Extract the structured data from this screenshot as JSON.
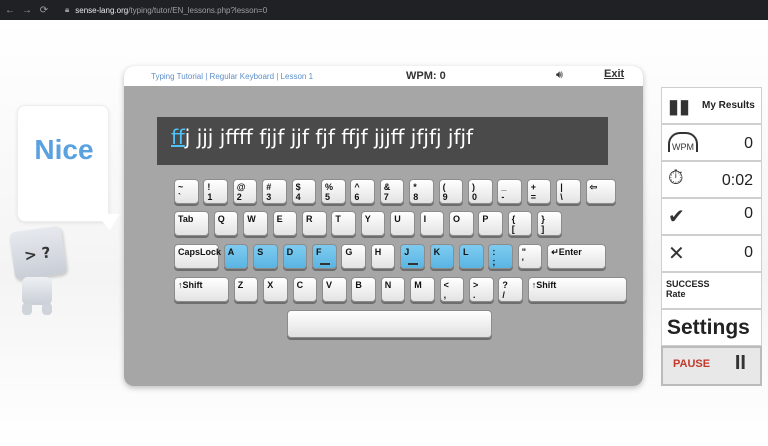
{
  "browser": {
    "back": "←",
    "forward": "→",
    "reload": "⟳",
    "url_host": "sense-lang.org",
    "url_path": "/typing/tutor/EN_lessons.php?lesson=0"
  },
  "feedback": {
    "word": "Nice"
  },
  "mascot": {
    "face": "> ?"
  },
  "header": {
    "breadcrumb": "Typing Tutorial | Regular Keyboard | Lesson 1",
    "wpm": "WPM: 0",
    "exit": "Exit"
  },
  "lesson": {
    "current_char": "f",
    "rest": "fj jjj jffff fjjf jjf fjf ffjf jjjff jfjfj jfjf"
  },
  "keyboard": {
    "row1": [
      [
        "~",
        "`"
      ],
      [
        "!",
        "1"
      ],
      [
        "@",
        "2"
      ],
      [
        "#",
        "3"
      ],
      [
        "$",
        "4"
      ],
      [
        "%",
        "5"
      ],
      [
        "^",
        "6"
      ],
      [
        "&",
        "7"
      ],
      [
        "*",
        "8"
      ],
      [
        "(",
        "9"
      ],
      [
        ")",
        "0"
      ],
      [
        "_",
        "-"
      ],
      [
        "+",
        "="
      ],
      [
        "|",
        "\\"
      ],
      [
        "⇦",
        ""
      ]
    ],
    "row2": [
      [
        "Tab",
        ""
      ],
      [
        "Q",
        ""
      ],
      [
        "W",
        ""
      ],
      [
        "E",
        ""
      ],
      [
        "R",
        ""
      ],
      [
        "T",
        ""
      ],
      [
        "Y",
        ""
      ],
      [
        "U",
        ""
      ],
      [
        "I",
        ""
      ],
      [
        "O",
        ""
      ],
      [
        "P",
        ""
      ],
      [
        "{",
        "["
      ],
      [
        "}",
        "]"
      ]
    ],
    "row3": [
      [
        "CapsLock",
        ""
      ],
      [
        "A",
        ""
      ],
      [
        "S",
        ""
      ],
      [
        "D",
        ""
      ],
      [
        "F",
        ""
      ],
      [
        "G",
        ""
      ],
      [
        "H",
        ""
      ],
      [
        "J",
        ""
      ],
      [
        "K",
        ""
      ],
      [
        "L",
        ""
      ],
      [
        ":",
        ";"
      ],
      [
        "\"",
        "'"
      ],
      [
        "↵Enter",
        ""
      ]
    ],
    "row4": [
      [
        "↑Shift",
        ""
      ],
      [
        "Z",
        ""
      ],
      [
        "X",
        ""
      ],
      [
        "C",
        ""
      ],
      [
        "V",
        ""
      ],
      [
        "B",
        ""
      ],
      [
        "N",
        ""
      ],
      [
        "M",
        ""
      ],
      [
        "<",
        ","
      ],
      [
        ">",
        "."
      ],
      [
        "?",
        "/"
      ],
      [
        "↑Shift",
        ""
      ]
    ]
  },
  "sidebar": {
    "results_label": "My Results",
    "wpm_badge": "WPM",
    "wpm_value": "0",
    "time_value": "0:02",
    "correct_value": "0",
    "errors_value": "0",
    "success_label": "SUCCESS",
    "rate_label": "Rate",
    "settings_label": "Settings",
    "pause_label": "PAUSE",
    "pause_icon": "II"
  },
  "icons": {
    "results": "bar-chart-icon",
    "speed": "speedometer-icon",
    "timer": "stopwatch-icon",
    "correct": "check-icon",
    "errors": "x-icon",
    "sound": "speaker-icon"
  },
  "colors": {
    "highlight_key": "#5ab5e2",
    "feedback": "#5aa1e0",
    "pause": "#c0392b"
  }
}
